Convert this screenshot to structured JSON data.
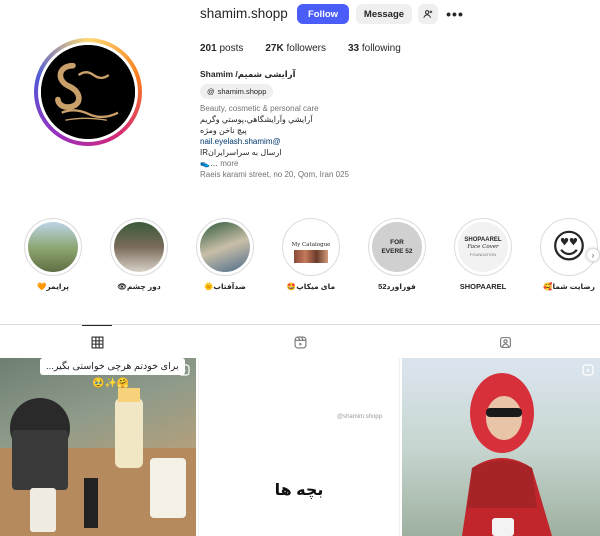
{
  "header": {
    "username": "shamim.shopp",
    "follow_label": "Follow",
    "message_label": "Message",
    "more_label": "•••",
    "stats": [
      {
        "value": "201",
        "label": "posts"
      },
      {
        "value": "27K",
        "label": "followers"
      },
      {
        "value": "33",
        "label": "following"
      }
    ]
  },
  "bio": {
    "name": "Shamim /آرایشی شمیم",
    "threads": "shamim.shopp",
    "category": "Beauty, cosmetic & personal care",
    "lines": [
      "آرایشي وآرایشگاهي،پوستي وگريم",
      "پيچ ناخن ومژه"
    ],
    "link": "nail.eyelash.shamim@",
    "shipping": "ارسال به سراسرايرانIR",
    "more_prefix": "…",
    "more": "more",
    "address": "Raeis karami street, no 20, Qom, Iran 025"
  },
  "highlights": [
    {
      "label": "پرايمر🧡",
      "text": ""
    },
    {
      "label": "دور چشم👁",
      "text": ""
    },
    {
      "label": "ضدآفتاب🌞",
      "text": ""
    },
    {
      "label": "مای میکاپ🤩",
      "text": "My Catalogue"
    },
    {
      "label": "فوراورد52",
      "text": "FOR EVERE 52"
    },
    {
      "label": "SHOPAAREL",
      "text": "SHOPAAREL"
    },
    {
      "label": "رضایت شما🥰",
      "text": ""
    }
  ],
  "highlight_brand": {
    "line1": "SHOPAAREL",
    "line2": "Face Cover",
    "line3": "FOUNDATION"
  },
  "tabs": [
    "posts-tab",
    "reels-tab",
    "tagged-tab"
  ],
  "posts": {
    "cell1_caption": "برای خودتم هرچی خواستی بگیر...",
    "cell1_emoji": "🥹✨🤗",
    "cell2_watermark": "@shamim.shopp",
    "cell2_text": "بچه ها"
  },
  "colors": {
    "follow": "#4a5df9",
    "gray_button": "#efefef",
    "link": "#00376b"
  }
}
